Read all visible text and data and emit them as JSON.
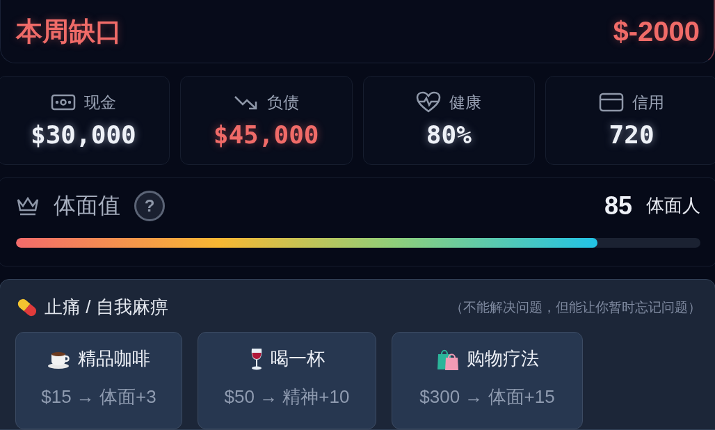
{
  "gap_card": {
    "title": "本周缺口",
    "amount": "$-2000"
  },
  "stats": [
    {
      "label": "现金",
      "value": "$30,000",
      "alert": false
    },
    {
      "label": "负债",
      "value": "$45,000",
      "alert": true
    },
    {
      "label": "健康",
      "value": "80%",
      "alert": false
    },
    {
      "label": "信用",
      "value": "720",
      "alert": false
    }
  ],
  "dignity": {
    "title": "体面值",
    "help": "?",
    "score": "85",
    "rank": "体面人",
    "level": 0.85
  },
  "relief": {
    "title": "止痛 / 自我麻痹",
    "note": "（不能解决问题，但能让你暂时忘记问题）",
    "actions": [
      {
        "name": "精品咖啡",
        "effect": "$15 → 体面+3"
      },
      {
        "name": "喝一杯",
        "effect": "$50 → 精神+10"
      },
      {
        "name": "购物疗法",
        "effect": "$300 → 体面+15"
      }
    ]
  }
}
